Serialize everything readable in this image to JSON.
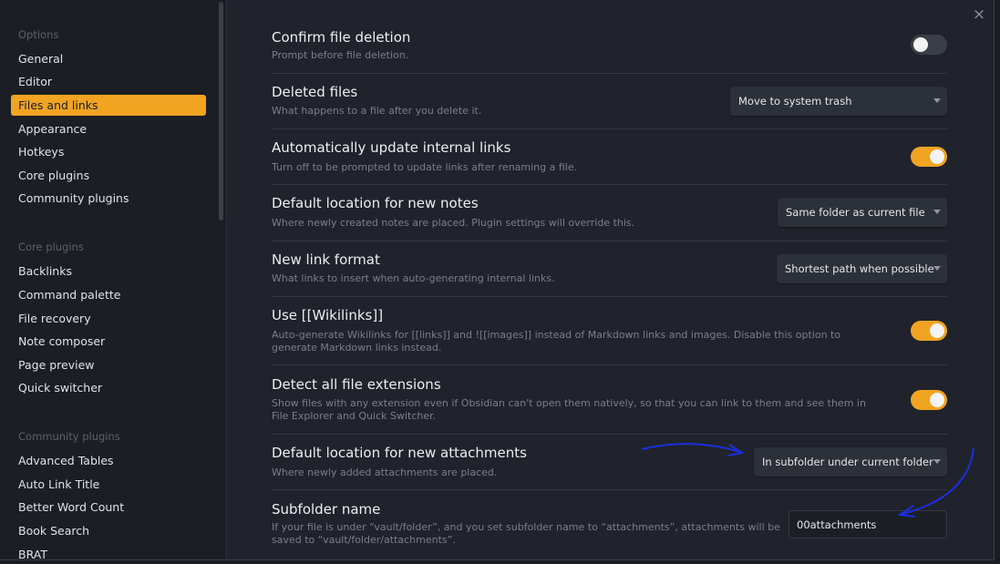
{
  "close_glyph": "×",
  "sidebar": {
    "sections": [
      {
        "label": "Options",
        "items": [
          "General",
          "Editor",
          "Files and links",
          "Appearance",
          "Hotkeys",
          "Core plugins",
          "Community plugins"
        ]
      },
      {
        "label": "Core plugins",
        "items": [
          "Backlinks",
          "Command palette",
          "File recovery",
          "Note composer",
          "Page preview",
          "Quick switcher"
        ]
      },
      {
        "label": "Community plugins",
        "items": [
          "Advanced Tables",
          "Auto Link Title",
          "Better Word Count",
          "Book Search",
          "BRAT"
        ]
      }
    ],
    "active_item": "Files and links"
  },
  "settings": {
    "confirm_delete": {
      "title": "Confirm file deletion",
      "desc": "Prompt before file deletion.",
      "toggle": false
    },
    "deleted_files": {
      "title": "Deleted files",
      "desc": "What happens to a file after you delete it.",
      "value": "Move to system trash"
    },
    "auto_update_links": {
      "title": "Automatically update internal links",
      "desc": "Turn off to be prompted to update links after renaming a file.",
      "toggle": true
    },
    "new_note_location": {
      "title": "Default location for new notes",
      "desc": "Where newly created notes are placed. Plugin settings will override this.",
      "value": "Same folder as current file"
    },
    "new_link_format": {
      "title": "New link format",
      "desc": "What links to insert when auto-generating internal links.",
      "value": "Shortest path when possible"
    },
    "wikilinks": {
      "title": "Use [[Wikilinks]]",
      "desc": "Auto-generate Wikilinks for [[links]] and ![[images]] instead of Markdown links and images. Disable this option to generate Markdown links instead.",
      "toggle": true
    },
    "detect_extensions": {
      "title": "Detect all file extensions",
      "desc": "Show files with any extension even if Obsidian can't open them natively, so that you can link to them and see them in File Explorer and Quick Switcher.",
      "toggle": true
    },
    "attachment_location": {
      "title": "Default location for new attachments",
      "desc": "Where newly added attachments are placed.",
      "value": "In subfolder under current folder"
    },
    "subfolder_name": {
      "title": "Subfolder name",
      "desc": "If your file is under “vault/folder”, and you set subfolder name to “attachments”, attachments will be saved to “vault/folder/attachments”.",
      "value": "00attachments"
    }
  },
  "colors": {
    "accent": "#f0a422",
    "annotation_arrow": "#1a2fe0"
  }
}
